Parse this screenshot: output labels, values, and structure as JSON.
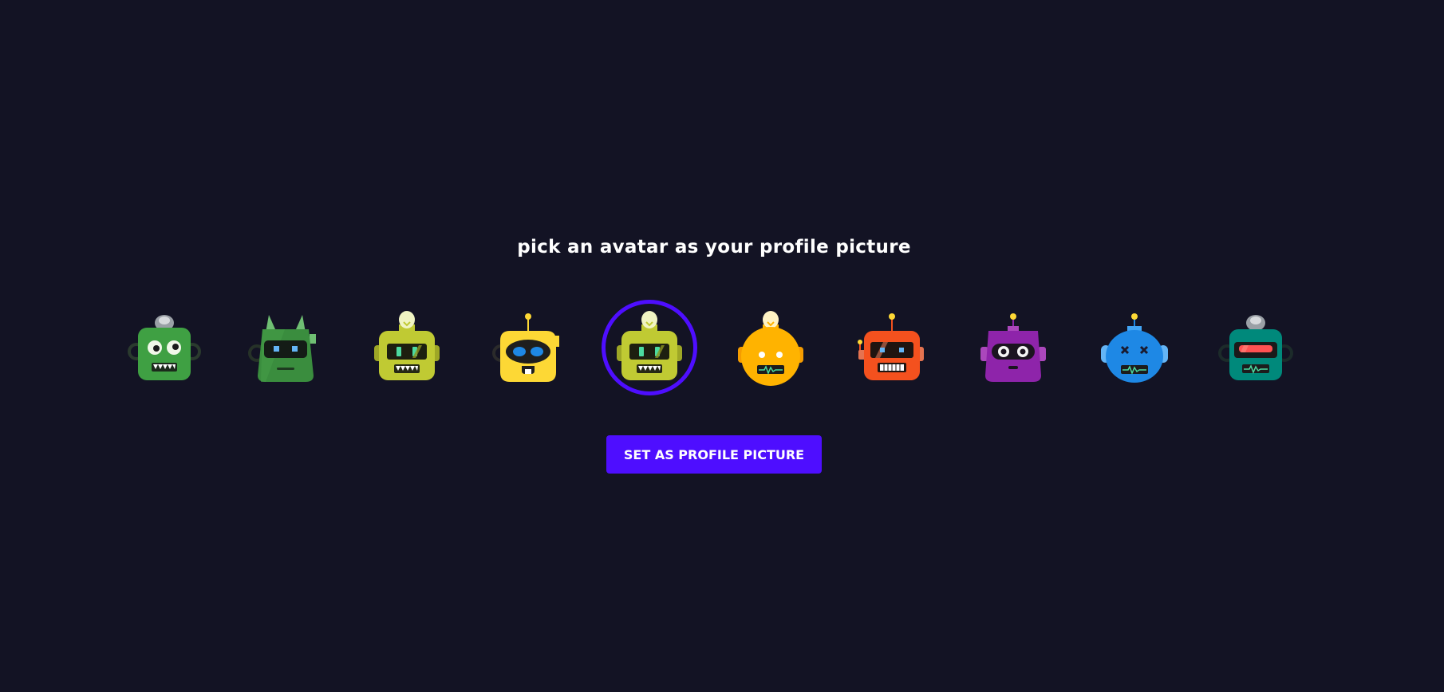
{
  "page": {
    "title": "pick an avatar as your profile picture",
    "button_label": "SET AS PROFILE PICTURE",
    "accent_color": "#4e0eff",
    "background_color": "#131324"
  },
  "avatars": [
    {
      "name": "green-round-eyed-robot",
      "color": "#3fa043",
      "selected": false
    },
    {
      "name": "green-horned-robot",
      "color": "#3a8d3e",
      "selected": false
    },
    {
      "name": "lime-bulb-robot",
      "color": "#c0ca33",
      "selected": false
    },
    {
      "name": "yellow-visor-robot",
      "color": "#fdd835",
      "selected": false
    },
    {
      "name": "lime-bulb-robot",
      "color": "#c0ca33",
      "selected": true
    },
    {
      "name": "orange-bulb-robot",
      "color": "#ffb300",
      "selected": false
    },
    {
      "name": "red-antenna-robot",
      "color": "#f4511e",
      "selected": false
    },
    {
      "name": "purple-antenna-robot",
      "color": "#8e24aa",
      "selected": false
    },
    {
      "name": "blue-antenna-robot",
      "color": "#1e88e5",
      "selected": false
    },
    {
      "name": "teal-dome-robot",
      "color": "#00897b",
      "selected": false
    }
  ]
}
